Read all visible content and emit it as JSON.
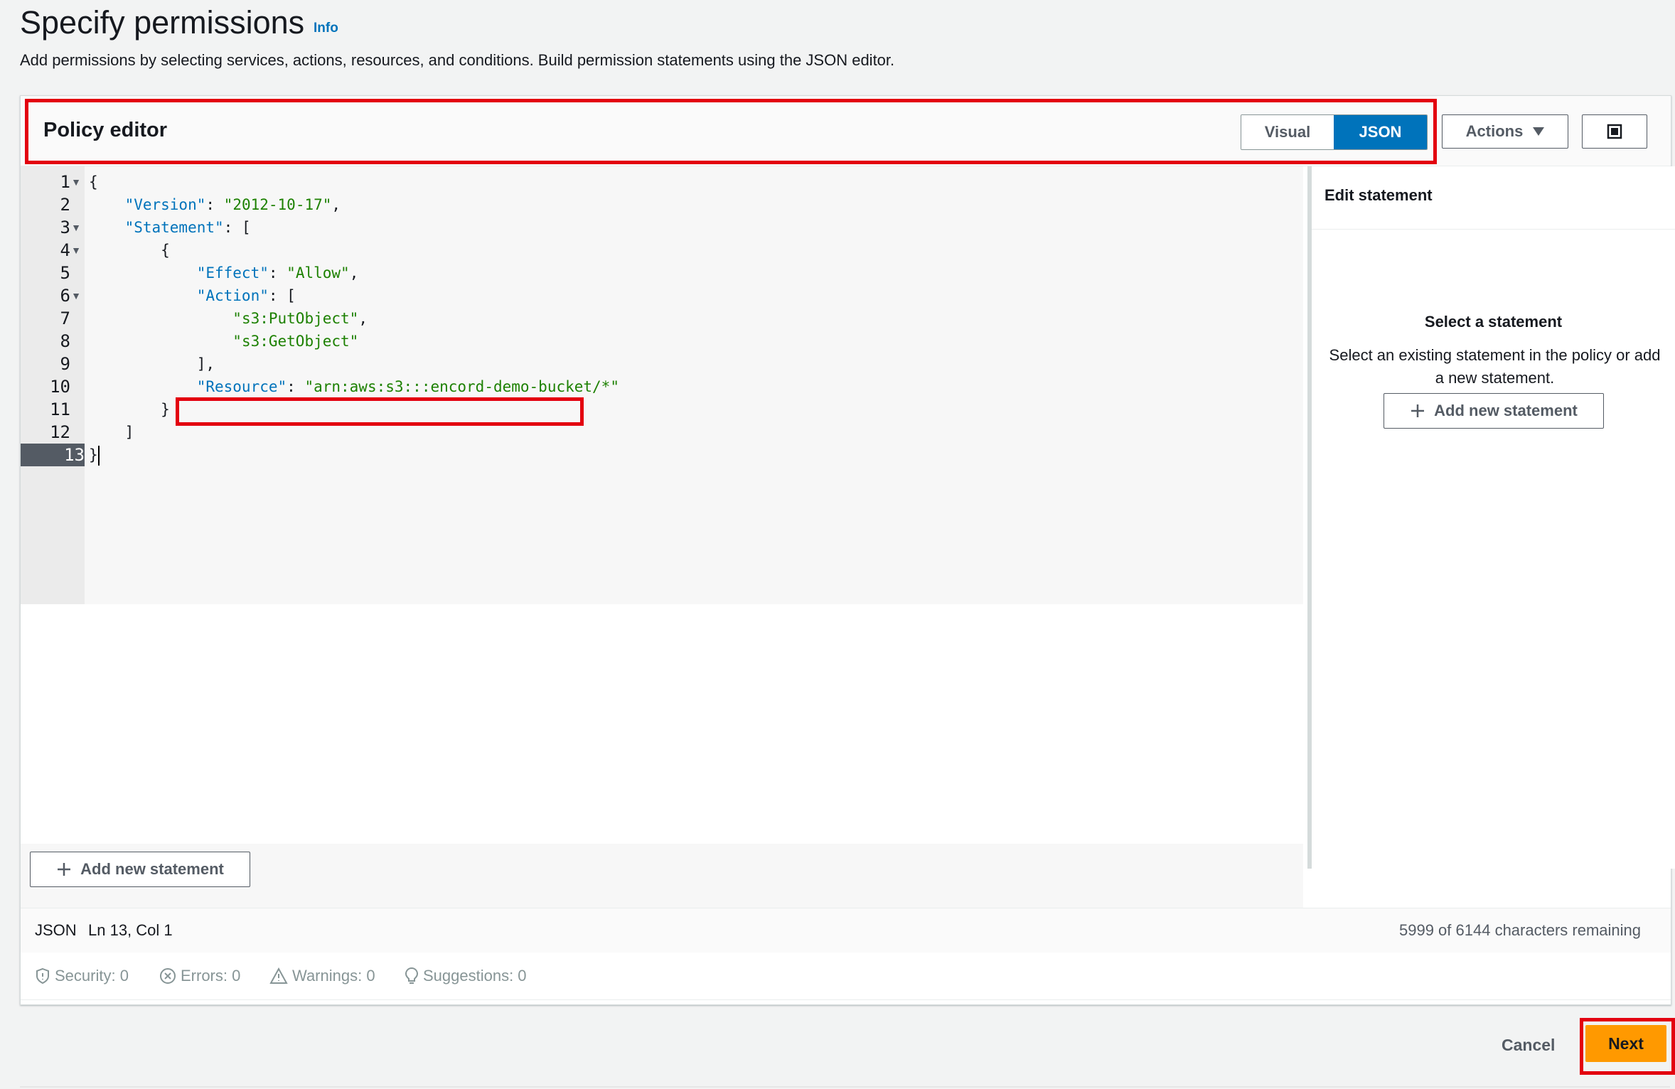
{
  "header": {
    "title": "Specify permissions",
    "info_label": "Info",
    "description": "Add permissions by selecting services, actions, resources, and conditions. Build permission statements using the JSON editor."
  },
  "policy_editor": {
    "title": "Policy editor",
    "mode_visual": "Visual",
    "mode_json": "JSON",
    "active_mode": "JSON",
    "actions_label": "Actions"
  },
  "code": {
    "line_numbers": [
      "1",
      "2",
      "3",
      "4",
      "5",
      "6",
      "7",
      "8",
      "9",
      "10",
      "11",
      "12",
      "13"
    ],
    "active_line": "13"
  },
  "edit_statement": {
    "title": "Edit statement",
    "select_heading": "Select a statement",
    "select_text": "Select an existing statement in the policy or add a new statement.",
    "add_button": "Add new statement"
  },
  "bottom": {
    "add_button": "Add new statement"
  },
  "status": {
    "language": "JSON",
    "position": "Ln 13, Col 1",
    "remaining": "5999 of 6144 characters remaining"
  },
  "checks": {
    "security": "Security: 0",
    "errors": "Errors: 0",
    "warnings": "Warnings: 0",
    "suggestions": "Suggestions: 0"
  },
  "footer": {
    "cancel": "Cancel",
    "next": "Next"
  },
  "colors": {
    "accent": "#0073bb",
    "primary_button": "#ff9900",
    "highlight": "#e3000f"
  }
}
